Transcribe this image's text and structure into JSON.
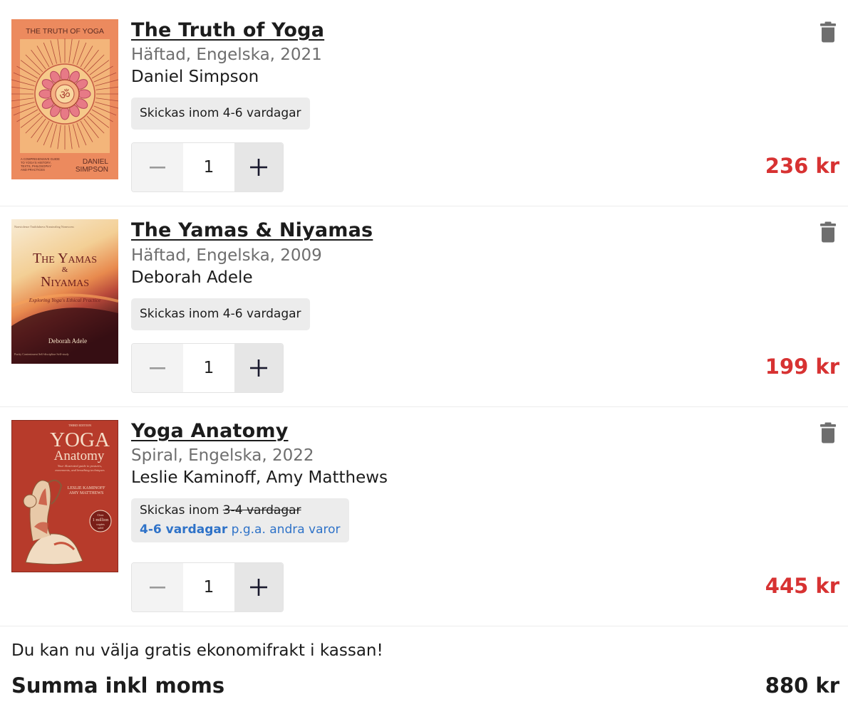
{
  "cart": {
    "items": [
      {
        "title": "The Truth of Yoga",
        "meta": "Häftad, Engelska, 2021",
        "author": "Daniel Simpson",
        "shipping": "Skickas inom 4-6 vardagar",
        "quantity": "1",
        "price": "236 kr",
        "cover": {
          "title": "THE TRUTH OF YOGA",
          "subtitle_lines": [
            "A COMPREHENSIVE GUIDE",
            "TO YOGA'S HISTORY,",
            "TEXTS, PHILOSOPHY",
            "AND PRACTICES"
          ],
          "author_lines": [
            "DANIEL",
            "SIMPSON"
          ],
          "symbol": "ॐ",
          "bg_color": "#ec8a5e"
        }
      },
      {
        "title": "The Yamas & Niyamas",
        "meta": "Häftad, Engelska, 2009",
        "author": "Deborah Adele",
        "shipping": "Skickas inom 4-6 vardagar",
        "quantity": "1",
        "price": "199 kr",
        "cover": {
          "title_line1": "The Yamas",
          "title_amp": "&",
          "title_line2": "Niyamas",
          "subtitle": "Exploring Yoga's Ethical Practice",
          "author": "Deborah Adele",
          "top_words": "Nonviolence Truthfulness Nonstealing Nonexcess",
          "bottom_words": "Purity Contentment Self-discipline Self-study"
        }
      },
      {
        "title": "Yoga Anatomy",
        "meta": "Spiral, Engelska, 2022",
        "author": "Leslie Kaminoff, Amy Matthews",
        "shipping_prefix": "Skickas inom",
        "shipping_old": "3-4 vardagar",
        "shipping_new": "4-6 vardagar",
        "shipping_reason": "p.g.a. andra varor",
        "quantity": "1",
        "price": "445 kr",
        "cover": {
          "edition": "THIRD EDITION",
          "title_line1": "YOGA",
          "title_line2": "Anatomy",
          "subtitle_lines": [
            "Your illustrated guide to postures,",
            "movements, and breathing techniques"
          ],
          "author_lines": [
            "LESLIE KAMINOFF",
            "AMY MATTHEWS"
          ],
          "badge_lines": [
            "Over",
            "1 million",
            "copies",
            "sold"
          ]
        }
      }
    ],
    "free_shipping_notice": "Du kan nu välja gratis ekonomifrakt i kassan!",
    "total_label": "Summa inkl moms",
    "total_value": "880 kr"
  },
  "colors": {
    "price": "#d73232",
    "link_blue": "#2e72c8",
    "badge_bg": "#ececec"
  },
  "icons": {
    "remove": "trash-icon",
    "decrease": "minus-icon",
    "increase": "plus-icon"
  }
}
